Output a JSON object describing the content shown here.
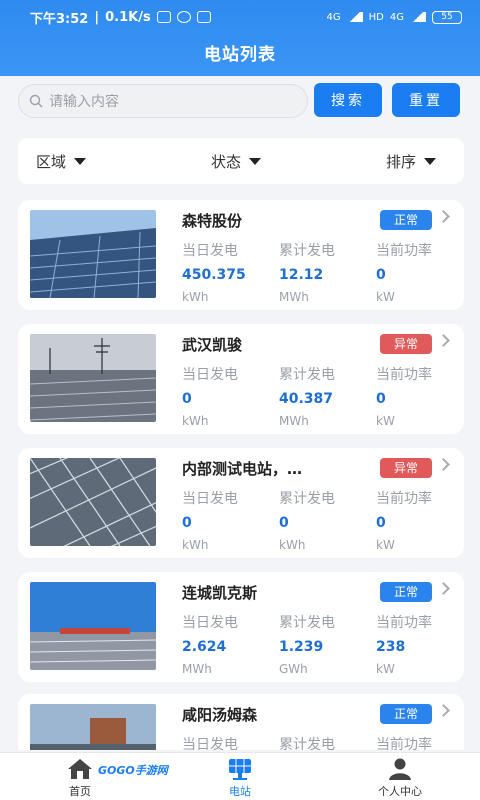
{
  "status_bar": {
    "time": "下午3:52",
    "speed": "0.1K/s",
    "net1": "4G",
    "hd": "HD",
    "net2": "4G",
    "battery": "55"
  },
  "header": {
    "title": "电站列表"
  },
  "search": {
    "placeholder": "请输入内容",
    "search_label": "搜索",
    "reset_label": "重置"
  },
  "filters": [
    {
      "label": "区域"
    },
    {
      "label": "状态"
    },
    {
      "label": "排序"
    }
  ],
  "metric_labels": {
    "today": "当日发电",
    "total": "累计发电",
    "power": "当前功率"
  },
  "stations": [
    {
      "name": "森特股份",
      "status": "正常",
      "today": "450.375",
      "today_unit": "kWh",
      "total": "12.12",
      "total_unit": "MWh",
      "power": "0",
      "power_unit": "kW"
    },
    {
      "name": "武汉凯骏",
      "status": "异常",
      "today": "0",
      "today_unit": "kWh",
      "total": "40.387",
      "total_unit": "MWh",
      "power": "0",
      "power_unit": "kW"
    },
    {
      "name": "内部测试电站，…",
      "status": "异常",
      "today": "0",
      "today_unit": "kWh",
      "total": "0",
      "total_unit": "kWh",
      "power": "0",
      "power_unit": "kW"
    },
    {
      "name": "连城凯克斯",
      "status": "正常",
      "today": "2.624",
      "today_unit": "MWh",
      "total": "1.239",
      "total_unit": "GWh",
      "power": "238",
      "power_unit": "kW"
    },
    {
      "name": "咸阳汤姆森",
      "status": "正常",
      "today": "",
      "today_unit": "",
      "total": "",
      "total_unit": "",
      "power": "",
      "power_unit": ""
    }
  ],
  "tabs": [
    {
      "label": "首页"
    },
    {
      "label": "电站"
    },
    {
      "label": "个人中心"
    }
  ],
  "watermark": "GOGO手游网",
  "colors": {
    "primary": "#1a7ef2",
    "normal": "#2b84ee",
    "abnormal": "#e05a5a"
  }
}
